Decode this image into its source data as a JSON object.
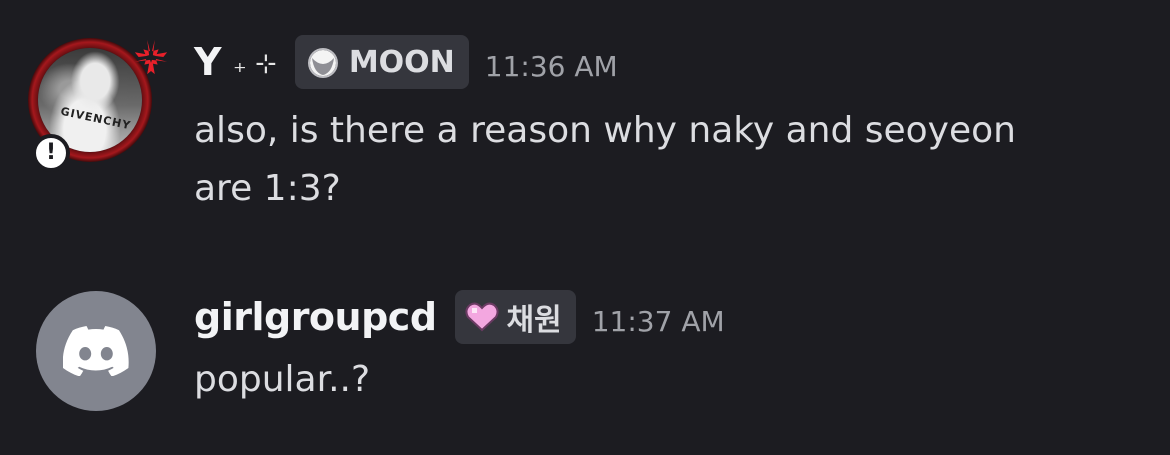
{
  "messages": [
    {
      "author": {
        "name": "Y",
        "name_deco": "₊ ⊹",
        "avatar": "profile-photo-with-angry-icon",
        "avatar_shirt_text": "GIVENCHY",
        "status_icon": "alert-icon",
        "ring_color": "#a5181d"
      },
      "role": {
        "icon": "moon-icon",
        "label": "MOON"
      },
      "timestamp": "11:36 AM",
      "lines": [
        "also, is there a reason why naky and seoyeon",
        "are 1:3?"
      ]
    },
    {
      "author": {
        "name": "girlgroupcd",
        "avatar": "discord-logo-icon",
        "avatar_color": "#82858f"
      },
      "role": {
        "icon": "pink-heart-icon",
        "label": "채원"
      },
      "timestamp": "11:37 AM",
      "lines": [
        "popular..?"
      ]
    }
  ],
  "colors": {
    "background": "#1c1c21",
    "username": "#f2f3f5",
    "text": "#dcdde1",
    "timestamp": "#a0a2a8",
    "role_tag_bg": "#35363d",
    "heart": "#f3a7e0"
  }
}
